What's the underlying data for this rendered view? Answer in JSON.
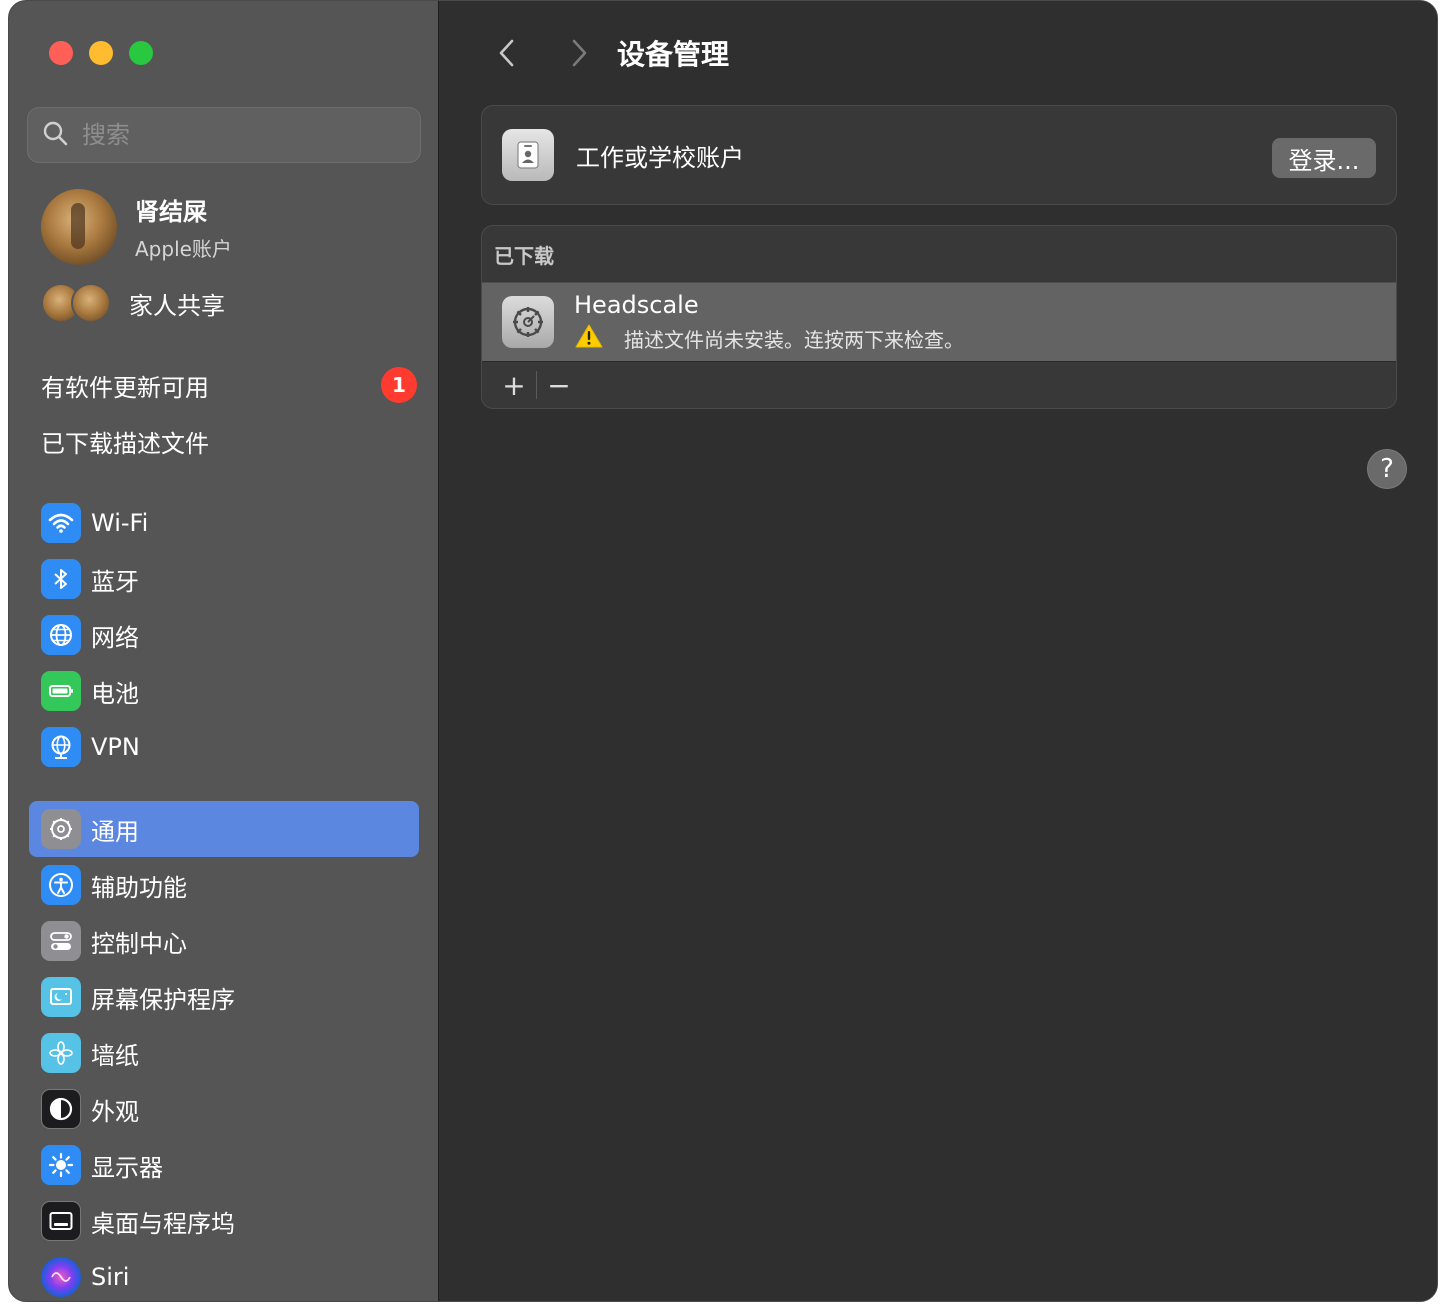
{
  "sidebar": {
    "search_placeholder": "搜索",
    "account": {
      "name": "肾结屎",
      "subtitle": "Apple账户"
    },
    "family_label": "家人共享",
    "software_update": {
      "label": "有软件更新可用",
      "badge": "1"
    },
    "downloaded_profiles_label": "已下载描述文件",
    "items": [
      {
        "label": "Wi-Fi",
        "icon": "wifi-icon"
      },
      {
        "label": "蓝牙",
        "icon": "bluetooth-icon"
      },
      {
        "label": "网络",
        "icon": "globe-icon"
      },
      {
        "label": "电池",
        "icon": "battery-icon"
      },
      {
        "label": "VPN",
        "icon": "vpn-globe-icon"
      },
      {
        "label": "通用",
        "icon": "gear-icon",
        "selected": true
      },
      {
        "label": "辅助功能",
        "icon": "accessibility-icon"
      },
      {
        "label": "控制中心",
        "icon": "control-center-icon"
      },
      {
        "label": "屏幕保护程序",
        "icon": "screensaver-icon"
      },
      {
        "label": "墙纸",
        "icon": "flower-icon"
      },
      {
        "label": "外观",
        "icon": "appearance-icon"
      },
      {
        "label": "显示器",
        "icon": "sun-icon"
      },
      {
        "label": "桌面与程序坞",
        "icon": "dock-icon"
      },
      {
        "label": "Siri",
        "icon": "siri-icon"
      }
    ]
  },
  "main": {
    "title": "设备管理",
    "work_account": {
      "label": "工作或学校账户",
      "button": "登录..."
    },
    "downloaded": {
      "header": "已下载",
      "profile": {
        "name": "Headscale",
        "status": "描述文件尚未安装。连按两下来检查。"
      },
      "add": "+",
      "remove": "−"
    },
    "help": "?"
  },
  "colors": {
    "sidebar_bg": "#555555",
    "main_bg": "#2f2f2f",
    "selection": "#5b87e0",
    "badge": "#ff3b30"
  }
}
